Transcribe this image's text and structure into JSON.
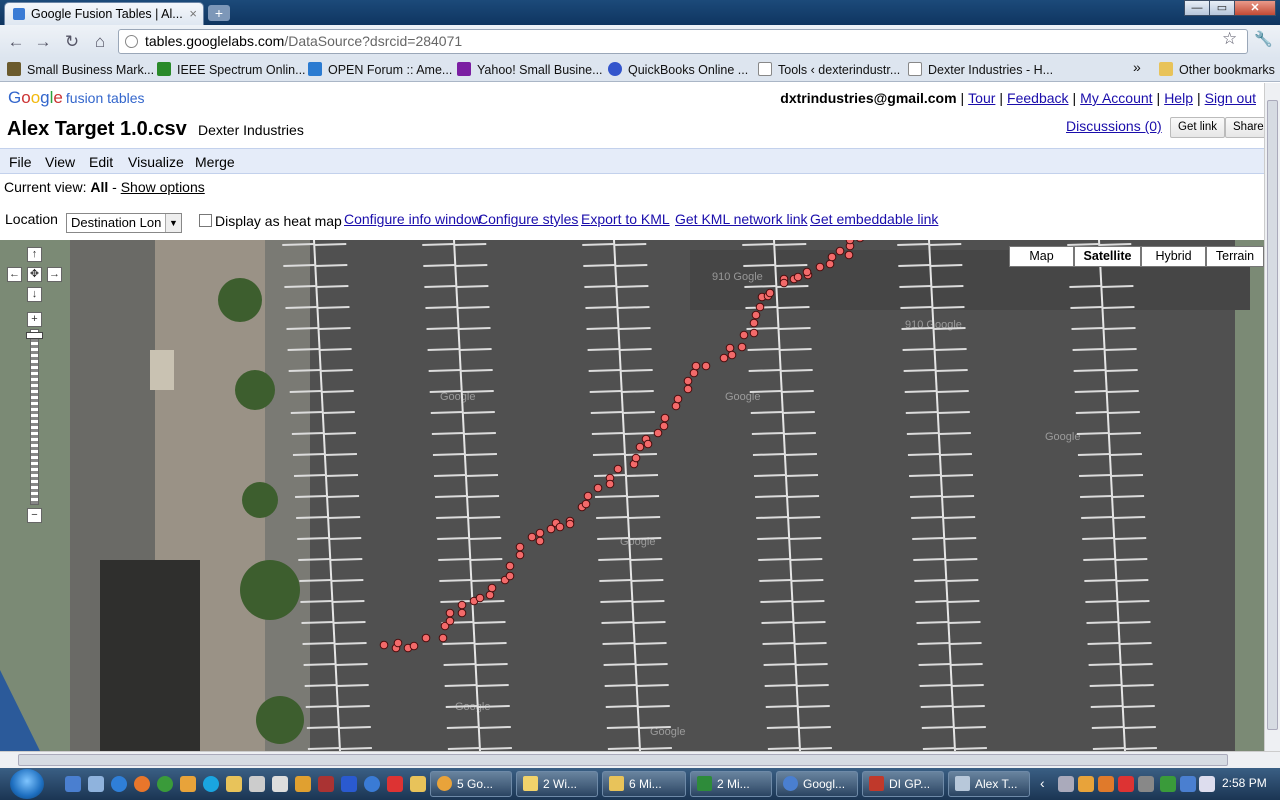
{
  "browser": {
    "tab_title": "Google Fusion Tables | Al...",
    "tab_close": "×",
    "new_tab": "+",
    "window_controls": {
      "minimize": "—",
      "maximize": "▭",
      "close": "✕"
    },
    "url_host": "tables.googlelabs.com",
    "url_path": "/DataSource?dsrcid=284071",
    "bookmarks": [
      {
        "label": "Small Business Mark...",
        "color": "#6b5b2e"
      },
      {
        "label": "IEEE Spectrum Onlin...",
        "color": "#2a8a2a"
      },
      {
        "label": "OPEN Forum :: Ame...",
        "color": "#2b7bd1"
      },
      {
        "label": "Yahoo! Small Busine...",
        "color": "#7b1fa2"
      },
      {
        "label": "QuickBooks Online ...",
        "color": "#3355cc"
      },
      {
        "label": "Tools ‹ dexterindustr...",
        "color": "#dddddd"
      },
      {
        "label": "Dexter Industries - H...",
        "color": "#dddddd"
      }
    ],
    "bookmarks_overflow": "»",
    "other_bookmarks": "Other bookmarks"
  },
  "header": {
    "logo_letters": [
      "G",
      "o",
      "o",
      "g",
      "l",
      "e"
    ],
    "product": "fusion tables",
    "email": "dxtrindustries@gmail.com",
    "links": [
      "Tour",
      "Feedback",
      "My Account",
      "Help",
      "Sign out"
    ],
    "table_title": "Alex Target 1.0.csv",
    "owner": "Dexter Industries",
    "discussions": "Discussions (0)",
    "get_link": "Get link",
    "share": "Share"
  },
  "menu": [
    "File",
    "View",
    "Edit",
    "Visualize",
    "Merge"
  ],
  "view": {
    "label": "Current view:",
    "value": "All",
    "dash": "-",
    "show_options": "Show options"
  },
  "map_options": {
    "location_label": "Location",
    "location_value": "Destination Lon",
    "heatmap_label": "Display as heat map",
    "heatmap_checked": false,
    "links": [
      "Configure info window",
      "Configure styles",
      "Export to KML",
      "Get KML network link",
      "Get embeddable link"
    ]
  },
  "map": {
    "types": [
      "Map",
      "Satellite",
      "Hybrid",
      "Terrain"
    ],
    "selected_type": "Satellite",
    "labels": [
      "910 Gogle",
      "910 Google",
      "Google",
      "Google",
      "Google",
      "Google",
      "Google",
      "Google"
    ],
    "marker_color": "#f36a6a"
  },
  "taskbar": {
    "tasks": [
      {
        "label": "5 Go...",
        "color": "#e9a33a"
      },
      {
        "label": "2 Wi...",
        "color": "#f2d36b"
      },
      {
        "label": "6 Mi...",
        "color": "#e8c35a"
      },
      {
        "label": "2 Mi...",
        "color": "#2e8b3a"
      },
      {
        "label": "Googl...",
        "color": "#4a7fd0"
      },
      {
        "label": "DI GP...",
        "color": "#c0392b"
      },
      {
        "label": "Alex T...",
        "color": "#b8c8da"
      }
    ],
    "clock": "2:58 PM"
  }
}
